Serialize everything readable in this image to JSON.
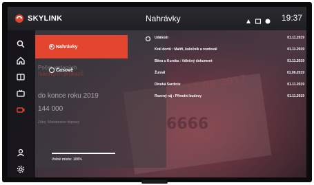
{
  "brand": {
    "name": "SKYLINK",
    "logo_color": "#e3452e"
  },
  "header": {
    "title": "Nahrávky",
    "time": "19:37",
    "status_icons": [
      "record-icon",
      "screen-icon",
      "network-icon"
    ]
  },
  "sidebar": {
    "items": [
      {
        "icon": "search-icon"
      },
      {
        "icon": "home-icon"
      },
      {
        "icon": "guide-icon"
      },
      {
        "icon": "tv-icon"
      },
      {
        "icon": "recordings-icon",
        "active": true
      },
      {
        "icon": "user-icon"
      },
      {
        "icon": "settings-icon"
      }
    ]
  },
  "sort_menu": {
    "options": [
      {
        "label": "Nahrávky",
        "selected": true
      },
      {
        "label": "Časově",
        "selected": false
      }
    ],
    "free_space_label": "Volné místo: 100%",
    "free_space_fraction": 1.0
  },
  "background_text": {
    "line1": "Počet vydaných",
    "line2": "řidičských průkazů",
    "line3": "do konce roku 2019",
    "line4": "144 000",
    "line5": "Zdroj: Ministerstvo dopravy"
  },
  "events": {
    "header": "Události",
    "header_date": "01.11.2019",
    "items": [
      {
        "title": "Král dortů : Malíři, kuločník a rozdovál",
        "date": "01.11.2019"
      },
      {
        "title": "Bitva u Kurska : Válečný dokument",
        "date": "01.11.2019"
      },
      {
        "title": "Žurnál",
        "date": "01.06.2019"
      },
      {
        "title": "Divoká Sardinie",
        "date": "01.11.2019"
      },
      {
        "title": "Rozený ráj : Přírodní budovy",
        "date": "01.11.2019"
      }
    ]
  },
  "accent_color": "#e3452e"
}
